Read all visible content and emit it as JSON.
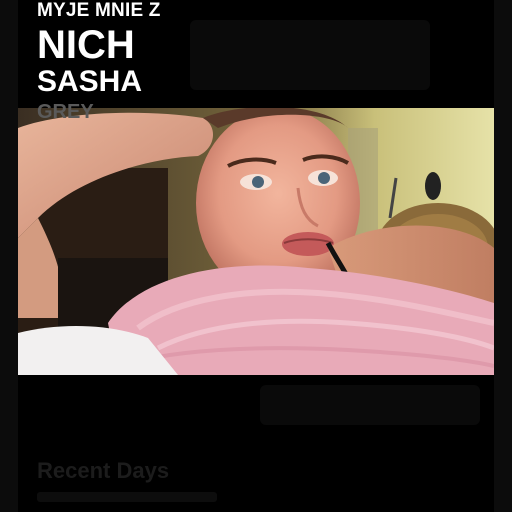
{
  "overlay": {
    "line1": "MYJE MNIE Z",
    "line2": "NICH",
    "line3": "SASHA",
    "line4": "GREY"
  },
  "section": {
    "title": "Recent Days"
  },
  "colors": {
    "background": "#000000",
    "title_text": "#ffffff",
    "muted_text": "#5a5a5a",
    "faded_text": "#1c1c1c",
    "blanket_pink": "#e8aab8"
  }
}
